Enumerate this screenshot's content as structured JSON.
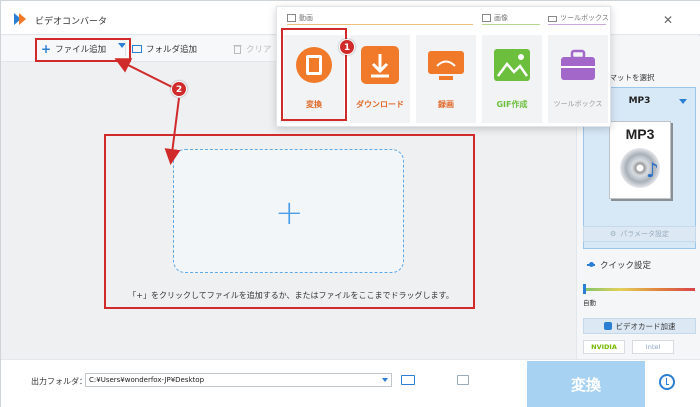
{
  "app": {
    "title": "ビデオコンバータ"
  },
  "toolbar": {
    "add_file": "ファイル追加",
    "add_folder": "フォルダ追加",
    "clear": "クリア"
  },
  "popup": {
    "sections": {
      "video": "動画",
      "image": "画像",
      "toolbox": "ツールボックス"
    },
    "tiles": [
      {
        "label": "変換",
        "icon": "film-icon",
        "color": "#f07a2a"
      },
      {
        "label": "ダウンロード",
        "icon": "download-icon",
        "color": "#f07a2a"
      },
      {
        "label": "録画",
        "icon": "monitor-icon",
        "color": "#f07a2a"
      },
      {
        "label": "GIF作成",
        "icon": "image-icon",
        "color": "#6cbf3c"
      },
      {
        "label": "ツールボックス",
        "icon": "toolbox-icon",
        "color": "#a367c9"
      }
    ]
  },
  "annotations": {
    "badge_1": "1",
    "badge_2": "2"
  },
  "dropzone": {
    "hint": "「+」をクリックしてファイルを追加するか、またはファイルをここまでドラッグします。"
  },
  "right_panel": {
    "format_label": "ーマットを選択",
    "format_value": "MP3",
    "format_art_text": "MP3",
    "params_button": "パラメータ設定",
    "quick_settings": "クイック設定",
    "slider_label": "自動",
    "gpu_button": "ビデオカード加速",
    "vendors": [
      "NVIDIA",
      "Intel"
    ]
  },
  "bottom": {
    "output_label": "出力フォルダ：",
    "output_path": "C:¥Users¥wonderfox-JP¥Desktop",
    "convert_button": "変換"
  },
  "colors": {
    "accent": "#2a7fd4",
    "annotation": "#d02a2a",
    "convert_bg": "#a7d2f2"
  }
}
